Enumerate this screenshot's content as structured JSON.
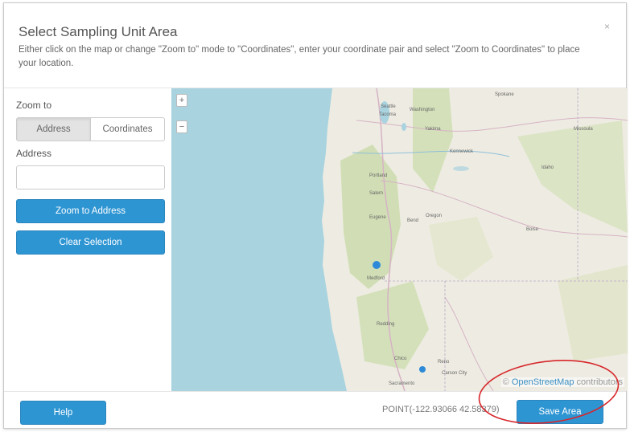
{
  "dialog": {
    "title": "Select Sampling Unit Area",
    "instructions": "Either click on the map or change \"Zoom to\" mode to \"Coordinates\", enter your coordinate pair and select \"Zoom to Coordinates\" to place your location.",
    "close_label": "×"
  },
  "left_panel": {
    "zoom_to_label": "Zoom to",
    "modes": [
      "Address",
      "Coordinates"
    ],
    "selected_mode": "Address",
    "address_label": "Address",
    "address_value": "",
    "address_placeholder": "",
    "zoom_button": "Zoom to Address",
    "clear_button": "Clear Selection"
  },
  "map": {
    "zoom_in": "+",
    "zoom_out": "−",
    "attribution_prefix": "© ",
    "attribution_link": "OpenStreetMap",
    "attribution_suffix": " contributors",
    "places": [
      "Seattle",
      "Tacoma",
      "Yakima",
      "Spokane",
      "Missoula",
      "Kennewick",
      "Portland",
      "Salem",
      "Eugene",
      "Bend",
      "Oregon",
      "Boise",
      "Medford",
      "Redding",
      "Chico",
      "Reno",
      "Carson City",
      "Sacramento",
      "Washington",
      "Idaho"
    ],
    "colors": {
      "water": "#a9d3df",
      "land": "#eeece2",
      "forest": "#c9dbaa",
      "marker": "#2e8ad8"
    }
  },
  "footer": {
    "help_button": "Help",
    "point_text": "POINT(-122.93066 42.58379)",
    "save_button": "Save Area"
  }
}
